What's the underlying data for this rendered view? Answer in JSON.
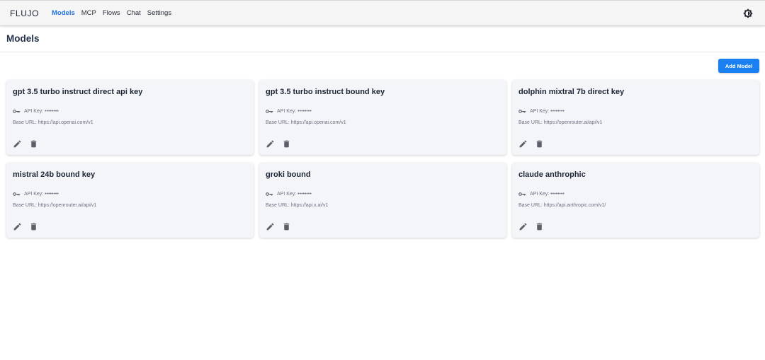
{
  "app": {
    "brand": "FLUJO",
    "nav": [
      {
        "label": "Models",
        "active": true
      },
      {
        "label": "MCP",
        "active": false
      },
      {
        "label": "Flows",
        "active": false
      },
      {
        "label": "Chat",
        "active": false
      },
      {
        "label": "Settings",
        "active": false
      }
    ],
    "theme_toggle_icon": "brightness-icon"
  },
  "page": {
    "title": "Models",
    "add_button_label": "Add Model"
  },
  "models": [
    {
      "name": "gpt 3.5 turbo instruct direct api key",
      "api_key_label": "API Key: ••••••••",
      "base_url_label": "Base URL: https://api.openai.com/v1"
    },
    {
      "name": "gpt 3.5 turbo instruct bound key",
      "api_key_label": "API Key: ••••••••",
      "base_url_label": "Base URL: https://api.openai.com/v1"
    },
    {
      "name": "dolphin mixtral 7b direct key",
      "api_key_label": "API Key: ••••••••",
      "base_url_label": "Base URL: https://openrouter.ai/api/v1"
    },
    {
      "name": "mistral 24b bound key",
      "api_key_label": "API Key: ••••••••",
      "base_url_label": "Base URL: https://openrouter.ai/api/v1"
    },
    {
      "name": "groki bound",
      "api_key_label": "API Key: ••••••••",
      "base_url_label": "Base URL: https://api.x.ai/v1"
    },
    {
      "name": "claude anthrophic",
      "api_key_label": "API Key: ••••••••",
      "base_url_label": "Base URL: https://api.anthropic.com/v1/"
    }
  ],
  "colors": {
    "accent": "#1a7ff0",
    "nav_active": "#1f72d6",
    "card_bg": "#f4f5f8",
    "icon": "#5b5f68"
  }
}
